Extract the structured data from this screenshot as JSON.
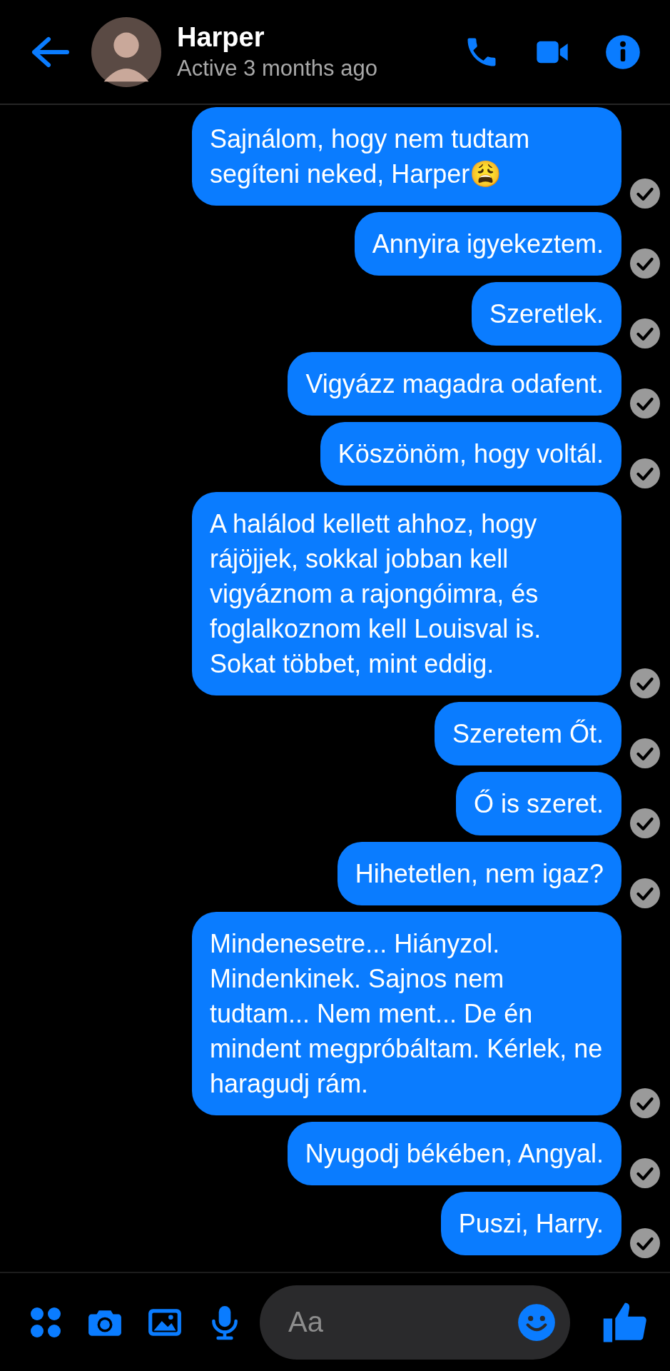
{
  "header": {
    "name": "Harper",
    "status": "Active 3 months ago"
  },
  "messages": [
    {
      "text": "Sajnálom, hogy nem tudtam segíteni neked, Harper😩"
    },
    {
      "text": "Annyira igyekeztem."
    },
    {
      "text": "Szeretlek."
    },
    {
      "text": "Vigyázz magadra odafent."
    },
    {
      "text": "Köszönöm, hogy voltál."
    },
    {
      "text": "A halálod kellett ahhoz, hogy rájöjjek, sokkal jobban kell vigyáznom a rajongóimra, és foglalkoznom kell Louisval is. Sokat többet, mint eddig."
    },
    {
      "text": "Szeretem Őt."
    },
    {
      "text": "Ő is szeret."
    },
    {
      "text": "Hihetetlen, nem igaz?"
    },
    {
      "text": "Mindenesetre... Hiányzol. Mindenkinek. Sajnos nem tudtam... Nem ment... De én mindent megpróbáltam. Kérlek, ne haragudj rám."
    },
    {
      "text": "Nyugodj békében, Angyal."
    },
    {
      "text": "Puszi, Harry."
    }
  ],
  "composer": {
    "placeholder": "Aa"
  }
}
